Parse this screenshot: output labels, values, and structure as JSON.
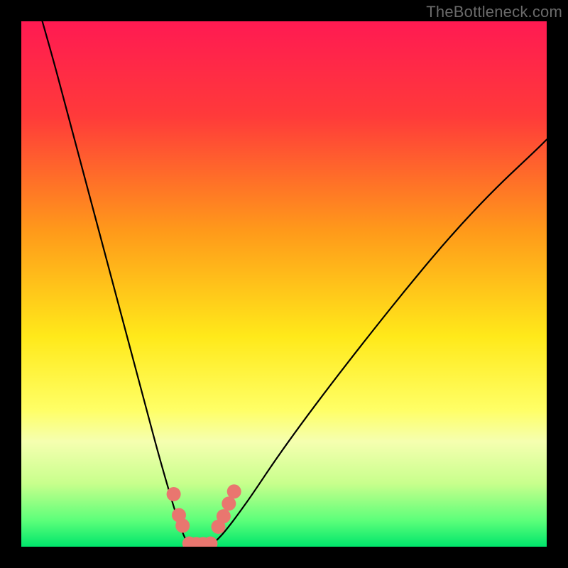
{
  "watermark": "TheBottleneck.com",
  "chart_data": {
    "type": "line",
    "title": "",
    "xlabel": "",
    "ylabel": "",
    "xlim": [
      0,
      100
    ],
    "ylim": [
      0,
      100
    ],
    "gradient_stops": [
      {
        "offset": 0,
        "color": "#ff1a52"
      },
      {
        "offset": 18,
        "color": "#ff3a3a"
      },
      {
        "offset": 40,
        "color": "#ff9a1a"
      },
      {
        "offset": 60,
        "color": "#ffe91a"
      },
      {
        "offset": 74,
        "color": "#ffff66"
      },
      {
        "offset": 80,
        "color": "#f5ffb0"
      },
      {
        "offset": 88,
        "color": "#c8ff8c"
      },
      {
        "offset": 95,
        "color": "#5cff7a"
      },
      {
        "offset": 100,
        "color": "#00e56b"
      }
    ],
    "series": [
      {
        "name": "left-curve",
        "x": [
          4,
          6,
          8,
          10,
          12,
          14,
          16,
          18,
          20,
          22,
          24,
          26,
          28,
          29.5,
          30.5,
          31.2,
          31.8
        ],
        "y": [
          100,
          93,
          85.5,
          78,
          70.5,
          63,
          55.5,
          48,
          40.5,
          33,
          25.5,
          18,
          11,
          6,
          3.2,
          1.5,
          0.6
        ]
      },
      {
        "name": "right-curve",
        "x": [
          36.5,
          37.5,
          39,
          41,
          44,
          48,
          53,
          59,
          66,
          74,
          82,
          90,
          98,
          100
        ],
        "y": [
          0.6,
          1.5,
          3.2,
          5.8,
          10,
          16,
          23,
          31,
          40,
          50,
          59.5,
          68,
          75.5,
          77.5
        ]
      }
    ],
    "markers": [
      {
        "name": "left-dot-1",
        "x": 29.0,
        "y": 10.0,
        "r": 1.5
      },
      {
        "name": "left-dot-2",
        "x": 30.0,
        "y": 6.0,
        "r": 1.5
      },
      {
        "name": "left-dot-3",
        "x": 30.7,
        "y": 4.0,
        "r": 1.5
      },
      {
        "name": "floor-dot-1",
        "x": 32.0,
        "y": 0.6,
        "r": 1.5
      },
      {
        "name": "floor-dot-2",
        "x": 33.3,
        "y": 0.5,
        "r": 1.5
      },
      {
        "name": "floor-dot-3",
        "x": 34.6,
        "y": 0.5,
        "r": 1.5
      },
      {
        "name": "floor-dot-4",
        "x": 36.0,
        "y": 0.6,
        "r": 1.5
      },
      {
        "name": "right-dot-1",
        "x": 37.5,
        "y": 3.8,
        "r": 1.5
      },
      {
        "name": "right-dot-2",
        "x": 38.5,
        "y": 5.8,
        "r": 1.5
      },
      {
        "name": "right-dot-3",
        "x": 39.5,
        "y": 8.2,
        "r": 1.5
      },
      {
        "name": "right-dot-4",
        "x": 40.5,
        "y": 10.5,
        "r": 1.5
      }
    ],
    "marker_color": "#e9766f"
  }
}
